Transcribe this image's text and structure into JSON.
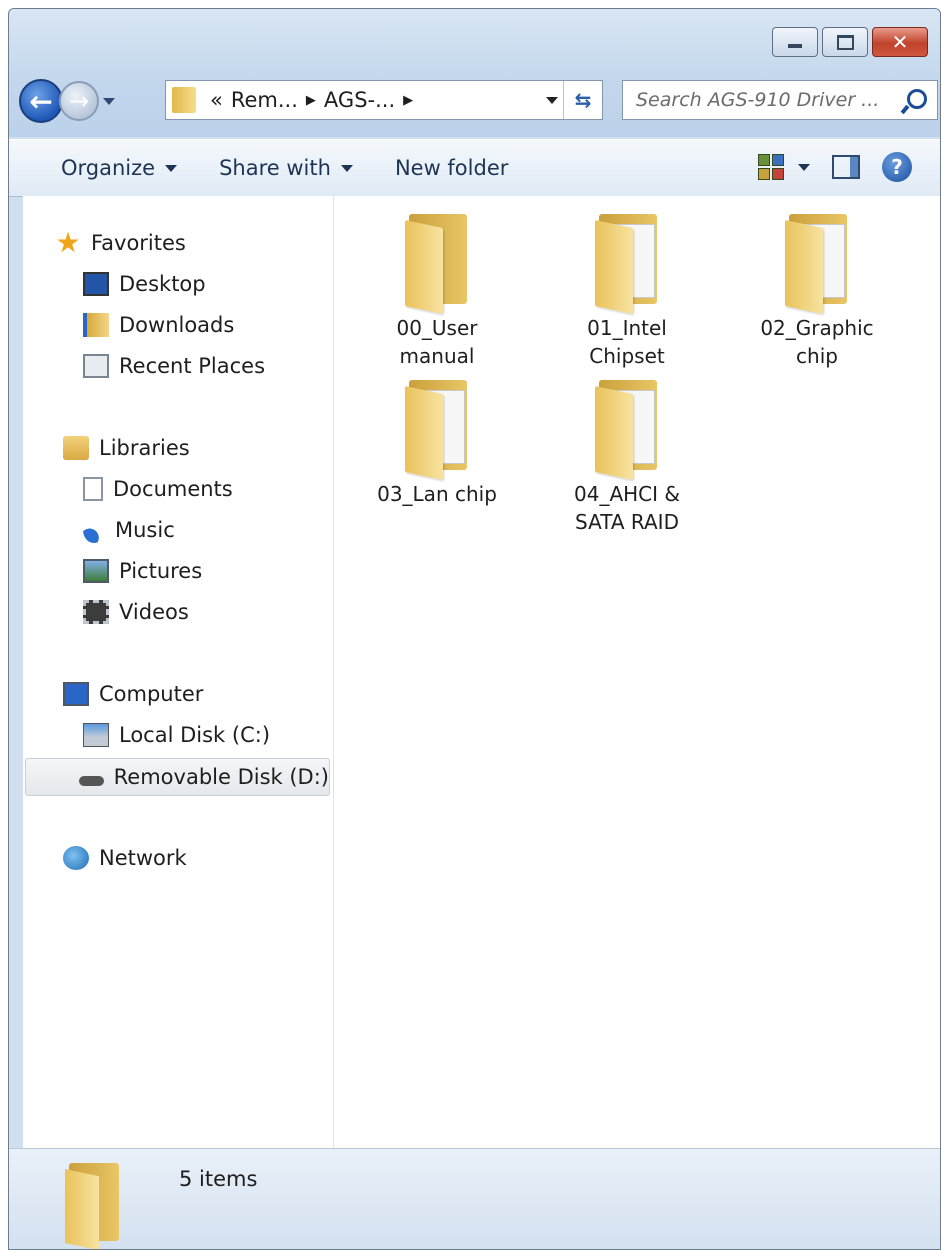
{
  "window": {
    "caption_buttons": [
      "minimize",
      "maximize",
      "close"
    ]
  },
  "nav": {
    "breadcrumb": {
      "prefix": "«",
      "parts": [
        "Rem...",
        "AGS-..."
      ]
    },
    "search_placeholder": "Search AGS-910 Driver ..."
  },
  "toolbar": {
    "organize": "Organize",
    "share_with": "Share with",
    "new_folder": "New folder"
  },
  "sidebar": {
    "favorites": {
      "label": "Favorites",
      "items": [
        "Desktop",
        "Downloads",
        "Recent Places"
      ]
    },
    "libraries": {
      "label": "Libraries",
      "items": [
        "Documents",
        "Music",
        "Pictures",
        "Videos"
      ]
    },
    "computer": {
      "label": "Computer",
      "items": [
        "Local Disk (C:)",
        "Removable Disk (D:)"
      ],
      "selected": "Removable Disk (D:)"
    },
    "network": {
      "label": "Network"
    }
  },
  "folders": [
    {
      "line1": "00_User",
      "line2": "manual"
    },
    {
      "line1": "01_Intel",
      "line2": "Chipset"
    },
    {
      "line1": "02_Graphic",
      "line2": "chip"
    },
    {
      "line1": "03_Lan chip",
      "line2": ""
    },
    {
      "line1": "04_AHCI &",
      "line2": "SATA RAID"
    }
  ],
  "status": {
    "count_text": "5 items"
  },
  "colors": {
    "accent": "#1f58b8",
    "folder": "#e9c25a",
    "frame": "#cfdfef"
  }
}
